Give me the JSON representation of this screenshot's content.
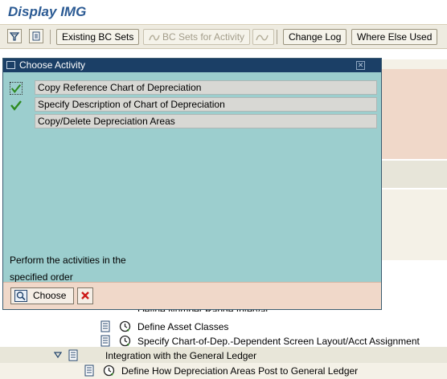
{
  "window": {
    "title": "Display IMG"
  },
  "toolbar": {
    "icons": [
      "filter-icon",
      "document-icon"
    ],
    "existing_bc_sets": "Existing BC Sets",
    "bc_sets_for_activity": "BC Sets for Activity",
    "change_log": "Change Log",
    "where_else_used": "Where Else Used"
  },
  "dialog": {
    "title": "Choose Activity",
    "activities": [
      {
        "label": "Copy Reference Chart of Depreciation",
        "checked": true
      },
      {
        "label": "Specify Description of Chart of Depreciation",
        "checked": true
      },
      {
        "label": "Copy/Delete Depreciation Areas",
        "checked": false
      }
    ],
    "message_line1": "Perform the activities in the",
    "message_line2": "specified order",
    "choose_button": "Choose",
    "cancel_icon": "cancel-icon"
  },
  "tree": {
    "items": [
      {
        "label": "Define Number Range Interval"
      },
      {
        "label": "Define Asset Classes"
      },
      {
        "label": "Specify Chart-of-Dep.-Dependent Screen Layout/Acct Assignment"
      },
      {
        "label": "Integration with the General Ledger"
      },
      {
        "label": "Define How Depreciation Areas Post to General Ledger"
      }
    ]
  },
  "colors": {
    "title": "#2b5a93",
    "dialog_body": "#9ccece",
    "dialog_titlebar": "#1b3f66",
    "dialog_footer": "#f0d8c9",
    "check": "#2e8a20",
    "cancel": "#cc1a1a"
  }
}
